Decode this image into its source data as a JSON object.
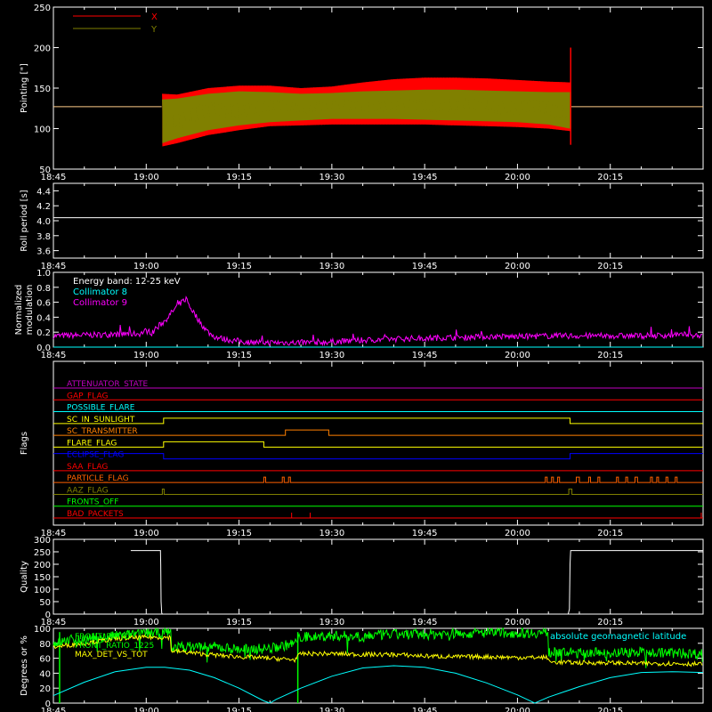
{
  "time_axis": {
    "tick_labels": [
      "18:45",
      "19:00",
      "19:15",
      "19:30",
      "19:45",
      "20:00",
      "20:15"
    ],
    "range_minutes": [
      0,
      105
    ],
    "tick_minutes": [
      0,
      15,
      30,
      45,
      60,
      75,
      90
    ]
  },
  "colors": {
    "background": "#000000",
    "axes": "#ffffff",
    "red": "#ff0000",
    "olive": "#808000",
    "cyan": "#00ffff",
    "magenta": "#ff00ff",
    "yellow": "#ffff00",
    "green": "#00ff00",
    "blue": "#0000ff",
    "orange": "#ff8000",
    "purple": "#c000c0",
    "dark_orange": "#ff6000"
  },
  "chart_data": [
    {
      "type": "line",
      "ylabel": "Pointing [\"]",
      "ylim": [
        50,
        250
      ],
      "yticks": [
        50,
        100,
        150,
        200,
        250
      ],
      "legend": [
        "X",
        "Y"
      ],
      "legend_placement": "top-left",
      "series": [
        {
          "name": "X",
          "color": "red",
          "envelope": [
            {
              "t": 17.5,
              "min": 120,
              "max": 127
            },
            {
              "t": 17.6,
              "min": 78,
              "max": 143
            },
            {
              "t": 20,
              "min": 82,
              "max": 142
            },
            {
              "t": 25,
              "min": 92,
              "max": 150
            },
            {
              "t": 30,
              "min": 98,
              "max": 153
            },
            {
              "t": 35,
              "min": 103,
              "max": 153
            },
            {
              "t": 40,
              "min": 104,
              "max": 150
            },
            {
              "t": 45,
              "min": 105,
              "max": 152
            },
            {
              "t": 50,
              "min": 105,
              "max": 157
            },
            {
              "t": 55,
              "min": 105,
              "max": 161
            },
            {
              "t": 60,
              "min": 105,
              "max": 163
            },
            {
              "t": 65,
              "min": 104,
              "max": 163
            },
            {
              "t": 70,
              "min": 103,
              "max": 162
            },
            {
              "t": 75,
              "min": 102,
              "max": 160
            },
            {
              "t": 80,
              "min": 100,
              "max": 158
            },
            {
              "t": 83.5,
              "min": 97,
              "max": 157
            },
            {
              "t": 83.6,
              "min": 80,
              "max": 200
            }
          ]
        },
        {
          "name": "Y",
          "color": "olive",
          "envelope": [
            {
              "t": 17.6,
              "min": 82,
              "max": 136
            },
            {
              "t": 20,
              "min": 88,
              "max": 137
            },
            {
              "t": 25,
              "min": 98,
              "max": 143
            },
            {
              "t": 30,
              "min": 104,
              "max": 146
            },
            {
              "t": 35,
              "min": 108,
              "max": 145
            },
            {
              "t": 40,
              "min": 110,
              "max": 143
            },
            {
              "t": 45,
              "min": 112,
              "max": 144
            },
            {
              "t": 50,
              "min": 112,
              "max": 146
            },
            {
              "t": 55,
              "min": 112,
              "max": 147
            },
            {
              "t": 60,
              "min": 111,
              "max": 148
            },
            {
              "t": 65,
              "min": 110,
              "max": 148
            },
            {
              "t": 70,
              "min": 109,
              "max": 147
            },
            {
              "t": 75,
              "min": 108,
              "max": 146
            },
            {
              "t": 80,
              "min": 105,
              "max": 145
            },
            {
              "t": 83.5,
              "min": 100,
              "max": 145
            }
          ]
        }
      ],
      "baseline": {
        "value": 127,
        "color": "#ffcc88"
      }
    },
    {
      "type": "line",
      "ylabel": "Roll period [s]",
      "ylim": [
        3.5,
        4.5
      ],
      "yticks": [
        3.6,
        3.8,
        4.0,
        4.2,
        4.4
      ],
      "series": [
        {
          "color": "axes",
          "points": [
            [
              0,
              4.04
            ],
            [
              105,
              4.04
            ]
          ]
        }
      ]
    },
    {
      "type": "line",
      "ylabel": "Normalized modulation",
      "ylim": [
        0,
        1
      ],
      "yticks": [
        0.0,
        0.2,
        0.4,
        0.6,
        0.8,
        1.0
      ],
      "legend": [
        "Energy band: 12-25 keV",
        "Collimator 8",
        "Collimator 9"
      ],
      "legend_colors": [
        "axes",
        "cyan",
        "magenta"
      ],
      "legend_placement": "top-left",
      "series": [
        {
          "name": "Collimator 8",
          "color": "cyan",
          "points": [
            [
              0,
              0.0
            ],
            [
              105,
              0.0
            ]
          ]
        },
        {
          "name": "Collimator 9",
          "color": "magenta",
          "points": [
            [
              0,
              0.15
            ],
            [
              5,
              0.16
            ],
            [
              10,
              0.17
            ],
            [
              14,
              0.18
            ],
            [
              15,
              0.22
            ],
            [
              16,
              0.19
            ],
            [
              17,
              0.28
            ],
            [
              18,
              0.35
            ],
            [
              19,
              0.45
            ],
            [
              20,
              0.55
            ],
            [
              21,
              0.62
            ],
            [
              21.5,
              0.65
            ],
            [
              22,
              0.55
            ],
            [
              23,
              0.42
            ],
            [
              24,
              0.3
            ],
            [
              25,
              0.2
            ],
            [
              26,
              0.14
            ],
            [
              28,
              0.1
            ],
            [
              31,
              0.07
            ],
            [
              35,
              0.06
            ],
            [
              40,
              0.06
            ],
            [
              45,
              0.07
            ],
            [
              50,
              0.09
            ],
            [
              55,
              0.11
            ],
            [
              60,
              0.12
            ],
            [
              65,
              0.13
            ],
            [
              70,
              0.14
            ],
            [
              75,
              0.14
            ],
            [
              80,
              0.15
            ],
            [
              85,
              0.15
            ],
            [
              90,
              0.15
            ],
            [
              95,
              0.15
            ],
            [
              100,
              0.16
            ],
            [
              105,
              0.16
            ]
          ]
        }
      ]
    },
    {
      "type": "flags",
      "ylabel": "Flags",
      "rows": [
        {
          "name": "ATTENUATOR_STATE",
          "color": "purple",
          "segments": []
        },
        {
          "name": "GAP_FLAG",
          "color": "red",
          "segments": []
        },
        {
          "name": "POSSIBLE_FLARE",
          "color": "cyan",
          "segments": []
        },
        {
          "name": "SC_IN_SUNLIGHT",
          "color": "yellow",
          "segments": [
            [
              17.8,
              83.5
            ]
          ]
        },
        {
          "name": "SC_TRANSMITTER",
          "color": "orange",
          "segments": [
            [
              37.5,
              44.5
            ]
          ]
        },
        {
          "name": "FLARE_FLAG",
          "color": "yellow",
          "segments": [
            [
              17.8,
              34.0
            ]
          ]
        },
        {
          "name": "ECLIPSE_FLAG",
          "color": "blue",
          "segments": [
            [
              0,
              17.8
            ],
            [
              83.5,
              105
            ]
          ],
          "inverted": true
        },
        {
          "name": "SAA_FLAG",
          "color": "red",
          "segments": []
        },
        {
          "name": "PARTICLE_FLAG",
          "color": "dark_orange",
          "segments": [
            [
              34.0,
              34.3
            ],
            [
              37.0,
              37.3
            ],
            [
              38.0,
              38.3
            ],
            [
              79.5,
              79.8
            ],
            [
              80.5,
              80.8
            ],
            [
              81.5,
              81.8
            ],
            [
              84.5,
              85.0
            ],
            [
              86.5,
              86.8
            ],
            [
              88.0,
              88.3
            ],
            [
              91.0,
              91.3
            ],
            [
              92.5,
              92.8
            ],
            [
              94.0,
              94.4
            ],
            [
              96.5,
              96.8
            ],
            [
              97.5,
              97.8
            ],
            [
              99.0,
              99.3
            ],
            [
              100.5,
              100.8
            ]
          ]
        },
        {
          "name": "AAZ_FLAG",
          "color": "olive",
          "segments": [
            [
              17.6,
              17.9
            ],
            [
              83.3,
              83.8
            ]
          ]
        },
        {
          "name": "FRONTS_OFF",
          "color": "green",
          "segments": []
        },
        {
          "name": "BAD_PACKETS",
          "color": "red",
          "spikes": [
            38.5,
            41.5,
            104.7
          ]
        }
      ]
    },
    {
      "type": "line",
      "ylabel": "Quality",
      "ylim": [
        0,
        300
      ],
      "yticks": [
        0,
        50,
        100,
        150,
        200,
        250,
        300
      ],
      "series": [
        {
          "color": "axes",
          "points": [
            [
              12.5,
              255
            ],
            [
              17.3,
              255
            ],
            [
              17.35,
              200
            ],
            [
              17.4,
              50
            ],
            [
              17.5,
              5
            ],
            [
              17.6,
              0
            ],
            [
              83.2,
              0
            ],
            [
              83.4,
              20
            ],
            [
              83.5,
              200
            ],
            [
              83.6,
              255
            ],
            [
              105,
              255
            ]
          ]
        }
      ]
    },
    {
      "type": "line",
      "ylabel": "Degrees or %",
      "ylim": [
        0,
        100
      ],
      "yticks": [
        0,
        20,
        40,
        60,
        80,
        100
      ],
      "legend": [
        "FRONT_RATIO",
        "FRONT_RATIO_1225",
        "MAX_DET_VS_TOT",
        "absolute geomagnetic latitude"
      ],
      "legend_colors": [
        "green",
        "green",
        "yellow",
        "cyan"
      ],
      "series": [
        {
          "name": "FRONT_RATIO",
          "color": "green",
          "points": [
            [
              0,
              80
            ],
            [
              3,
              85
            ],
            [
              8,
              88
            ],
            [
              13,
              92
            ],
            [
              19,
              95
            ],
            [
              19.1,
              75
            ],
            [
              25,
              76
            ],
            [
              30,
              72
            ],
            [
              35,
              73
            ],
            [
              39,
              80
            ],
            [
              40,
              88
            ],
            [
              45,
              90
            ],
            [
              50,
              90
            ],
            [
              55,
              92
            ],
            [
              60,
              92
            ],
            [
              65,
              93
            ],
            [
              70,
              94
            ],
            [
              75,
              94
            ],
            [
              80,
              94
            ],
            [
              80.1,
              68
            ],
            [
              85,
              67
            ],
            [
              90,
              68
            ],
            [
              95,
              68
            ],
            [
              100,
              67
            ],
            [
              105,
              66
            ]
          ],
          "drops": [
            1.0,
            39.5
          ]
        },
        {
          "name": "FRONT_RATIO_1225",
          "color": "green",
          "points": [
            [
              0,
              80
            ],
            [
              105,
              66
            ]
          ]
        },
        {
          "name": "MAX_DET_VS_TOT",
          "color": "yellow",
          "points": [
            [
              0,
              75
            ],
            [
              5,
              80
            ],
            [
              10,
              86
            ],
            [
              15,
              88
            ],
            [
              19,
              88
            ],
            [
              19.1,
              70
            ],
            [
              25,
              65
            ],
            [
              30,
              62
            ],
            [
              35,
              60
            ],
            [
              39,
              58
            ],
            [
              40,
              66
            ],
            [
              45,
              66
            ],
            [
              50,
              65
            ],
            [
              55,
              65
            ],
            [
              60,
              63
            ],
            [
              65,
              62
            ],
            [
              70,
              62
            ],
            [
              75,
              61
            ],
            [
              80,
              61
            ],
            [
              80.1,
              55
            ],
            [
              85,
              54
            ],
            [
              90,
              54
            ],
            [
              95,
              53
            ],
            [
              100,
              53
            ],
            [
              105,
              52
            ]
          ]
        },
        {
          "name": "absolute geomagnetic latitude",
          "color": "cyan",
          "points": [
            [
              0,
              10
            ],
            [
              5,
              28
            ],
            [
              10,
              42
            ],
            [
              15,
              48
            ],
            [
              18,
              48
            ],
            [
              22,
              44
            ],
            [
              26,
              34
            ],
            [
              30,
              20
            ],
            [
              34,
              3
            ],
            [
              35,
              0
            ],
            [
              36,
              5
            ],
            [
              40,
              20
            ],
            [
              45,
              36
            ],
            [
              50,
              47
            ],
            [
              55,
              50
            ],
            [
              60,
              48
            ],
            [
              65,
              40
            ],
            [
              70,
              27
            ],
            [
              75,
              11
            ],
            [
              77.8,
              0
            ],
            [
              80,
              8
            ],
            [
              85,
              22
            ],
            [
              90,
              34
            ],
            [
              95,
              41
            ],
            [
              100,
              42
            ],
            [
              105,
              41
            ]
          ]
        }
      ]
    }
  ]
}
